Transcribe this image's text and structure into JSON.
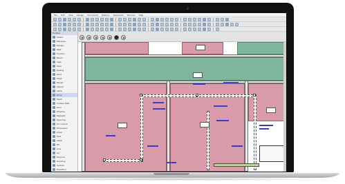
{
  "menu": [
    "File",
    "Edit",
    "View",
    "Design",
    "Document",
    "Options",
    "Teamwork",
    "Window",
    "Help"
  ],
  "toolbox": {
    "title": "Toolbox",
    "items": [
      "Select",
      "Marquee",
      "Design",
      "Wall",
      "Column",
      "Beam",
      "Slab",
      "Stair",
      "Railing",
      "Roof",
      "Shell",
      "Morph",
      "Object",
      "Lamp",
      "Zone",
      "Mesh",
      "Curtain Wall",
      "Door",
      "Window",
      "Skylight",
      "Opening",
      "Document",
      "Dimension",
      "Level",
      "Text",
      "Label",
      "Fill",
      "Line",
      "Arc",
      "Polyline",
      "Drawing",
      "Section",
      "Elevation",
      "Detail",
      "Worksheet",
      "Change"
    ],
    "selected_index": 14
  },
  "canvas": {
    "room_labels": [
      "",
      "",
      "",
      "",
      ""
    ],
    "tooltip": ""
  },
  "colors": {
    "zone_pink": "#d99aaa",
    "zone_green": "#7fb59d",
    "annotation_blue": "#3a3ad0"
  }
}
